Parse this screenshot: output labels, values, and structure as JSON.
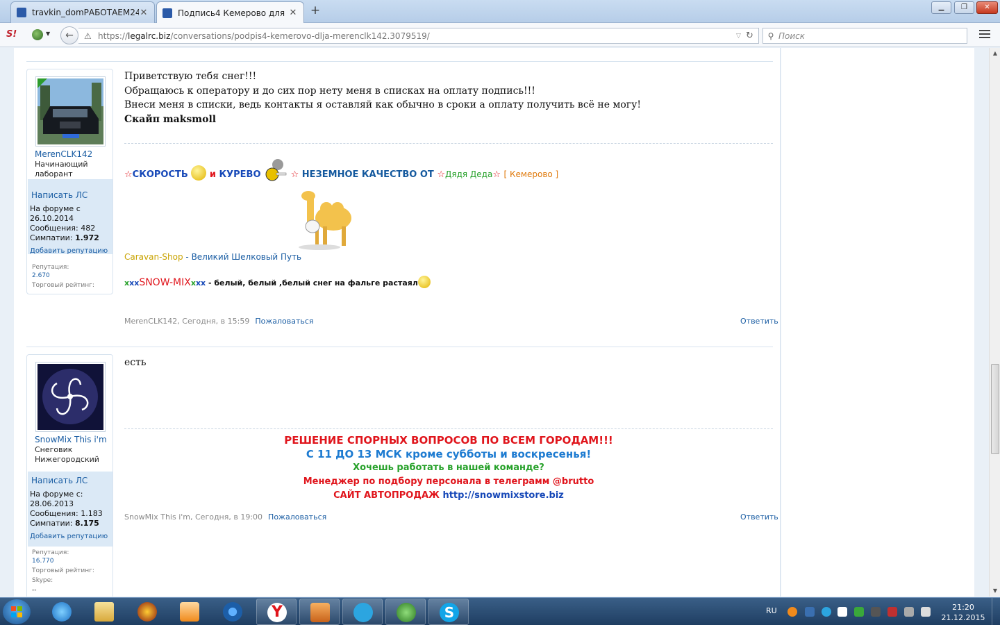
{
  "browser": {
    "tabs": [
      {
        "title": "travkin_domРАБОТАЕМ24...",
        "active": false,
        "favicon_color": "#2b5aa8"
      },
      {
        "title": "Подпись4 Кемерово для ...",
        "active": true,
        "favicon_color": "#2b5aa8"
      }
    ],
    "address": {
      "scheme": "https://",
      "domain": "legalrc.biz",
      "path": "/conversations/podpis4-kemerovo-dlja-merenclk142.3079519/"
    },
    "search_placeholder": "Поиск",
    "toolbar_logo": "S!"
  },
  "posts": [
    {
      "user": {
        "name": "MerenCLK142",
        "title": "Начинающий лаборант",
        "pm_label": "Написать ЛС",
        "joined_label": "На форуме с",
        "joined": "26.10.2014",
        "messages_label": "Сообщения:",
        "messages": "482",
        "likes_label": "Симпатии:",
        "likes": "1.972",
        "add_rep": "Добавить репутацию",
        "rep_label": "Репутация:",
        "rep": "2.670",
        "trade_label": "Торговый рейтинг:"
      },
      "body": [
        "Приветствую тебя снег!!!",
        "Обращаюсь к оператору и до сих пор нету меня в списках на оплату подпись!!!",
        "Внеси меня в списки, ведь контакты я оставляй как обычно в сроки а оплату получить всё не могу!",
        "Скайп maksmoll"
      ],
      "signature": {
        "speed": "СКОРОСТЬ",
        "and": "и",
        "smoke": "КУРЕВО",
        "quality": "НЕЗЕМНОЕ КАЧЕСТВО ОТ",
        "author": "Дядя Деда",
        "city": "[ Кемерово ]",
        "shop": "Caravan-Shop",
        "shop_tail": "- Великий Шелковый Путь",
        "snow_prefix_green": "x",
        "snow_prefix_blue": "xx",
        "snow_name": "SNOW-MIX",
        "snow_suffix_green": "x",
        "snow_suffix_blue": "xx",
        "snow_tail": " - белый, белый ,белый снег на фальге растаял"
      },
      "meta": "MerenCLK142, Сегодня, в 15:59",
      "report": "Пожаловаться",
      "reply": "Ответить"
    },
    {
      "user": {
        "name": "SnowMix This i'm",
        "title": "Снеговик Нижегородский",
        "pm_label": "Написать ЛС",
        "joined_label": "На форуме с:",
        "joined": "28.06.2013",
        "messages_label": "Сообщения:",
        "messages": "1.183",
        "likes_label": "Симпатии:",
        "likes": "8.175",
        "add_rep": "Добавить репутацию",
        "rep_label": "Репутация:",
        "rep": "16.770",
        "trade_label": "Торговый рейтинг:",
        "skype_label": "Skype:",
        "skype": "--"
      },
      "body": [
        "есть"
      ],
      "signature": {
        "l1": "РЕШЕНИЕ СПОРНЫХ ВОПРОСОВ ПО ВСЕМ ГОРОДАМ!!!",
        "l2": "С 11 ДО 13 МСК кроме субботы и воскресенья!",
        "l3": "Хочешь работать в нашей команде?",
        "l4": "Менеджер по подбору персонала в телеграмм @brutto",
        "l5_prefix": "САЙТ АВТОПРОДАЖ",
        "l5_link": "http://snowmixstore.biz"
      },
      "meta": "SnowMix This i'm, Сегодня, в 19:00",
      "report": "Пожаловаться",
      "reply": "Ответить"
    }
  ],
  "taskbar": {
    "lang": "RU",
    "time": "21:20",
    "date": "21.12.2015",
    "pinned": [
      "ie-icon",
      "explorer-icon",
      "crossfire-icon",
      "media-player-icon",
      "chrome-icon",
      "yandex-icon",
      "guard-icon",
      "telegram-icon",
      "avast-icon",
      "skype-icon"
    ]
  }
}
